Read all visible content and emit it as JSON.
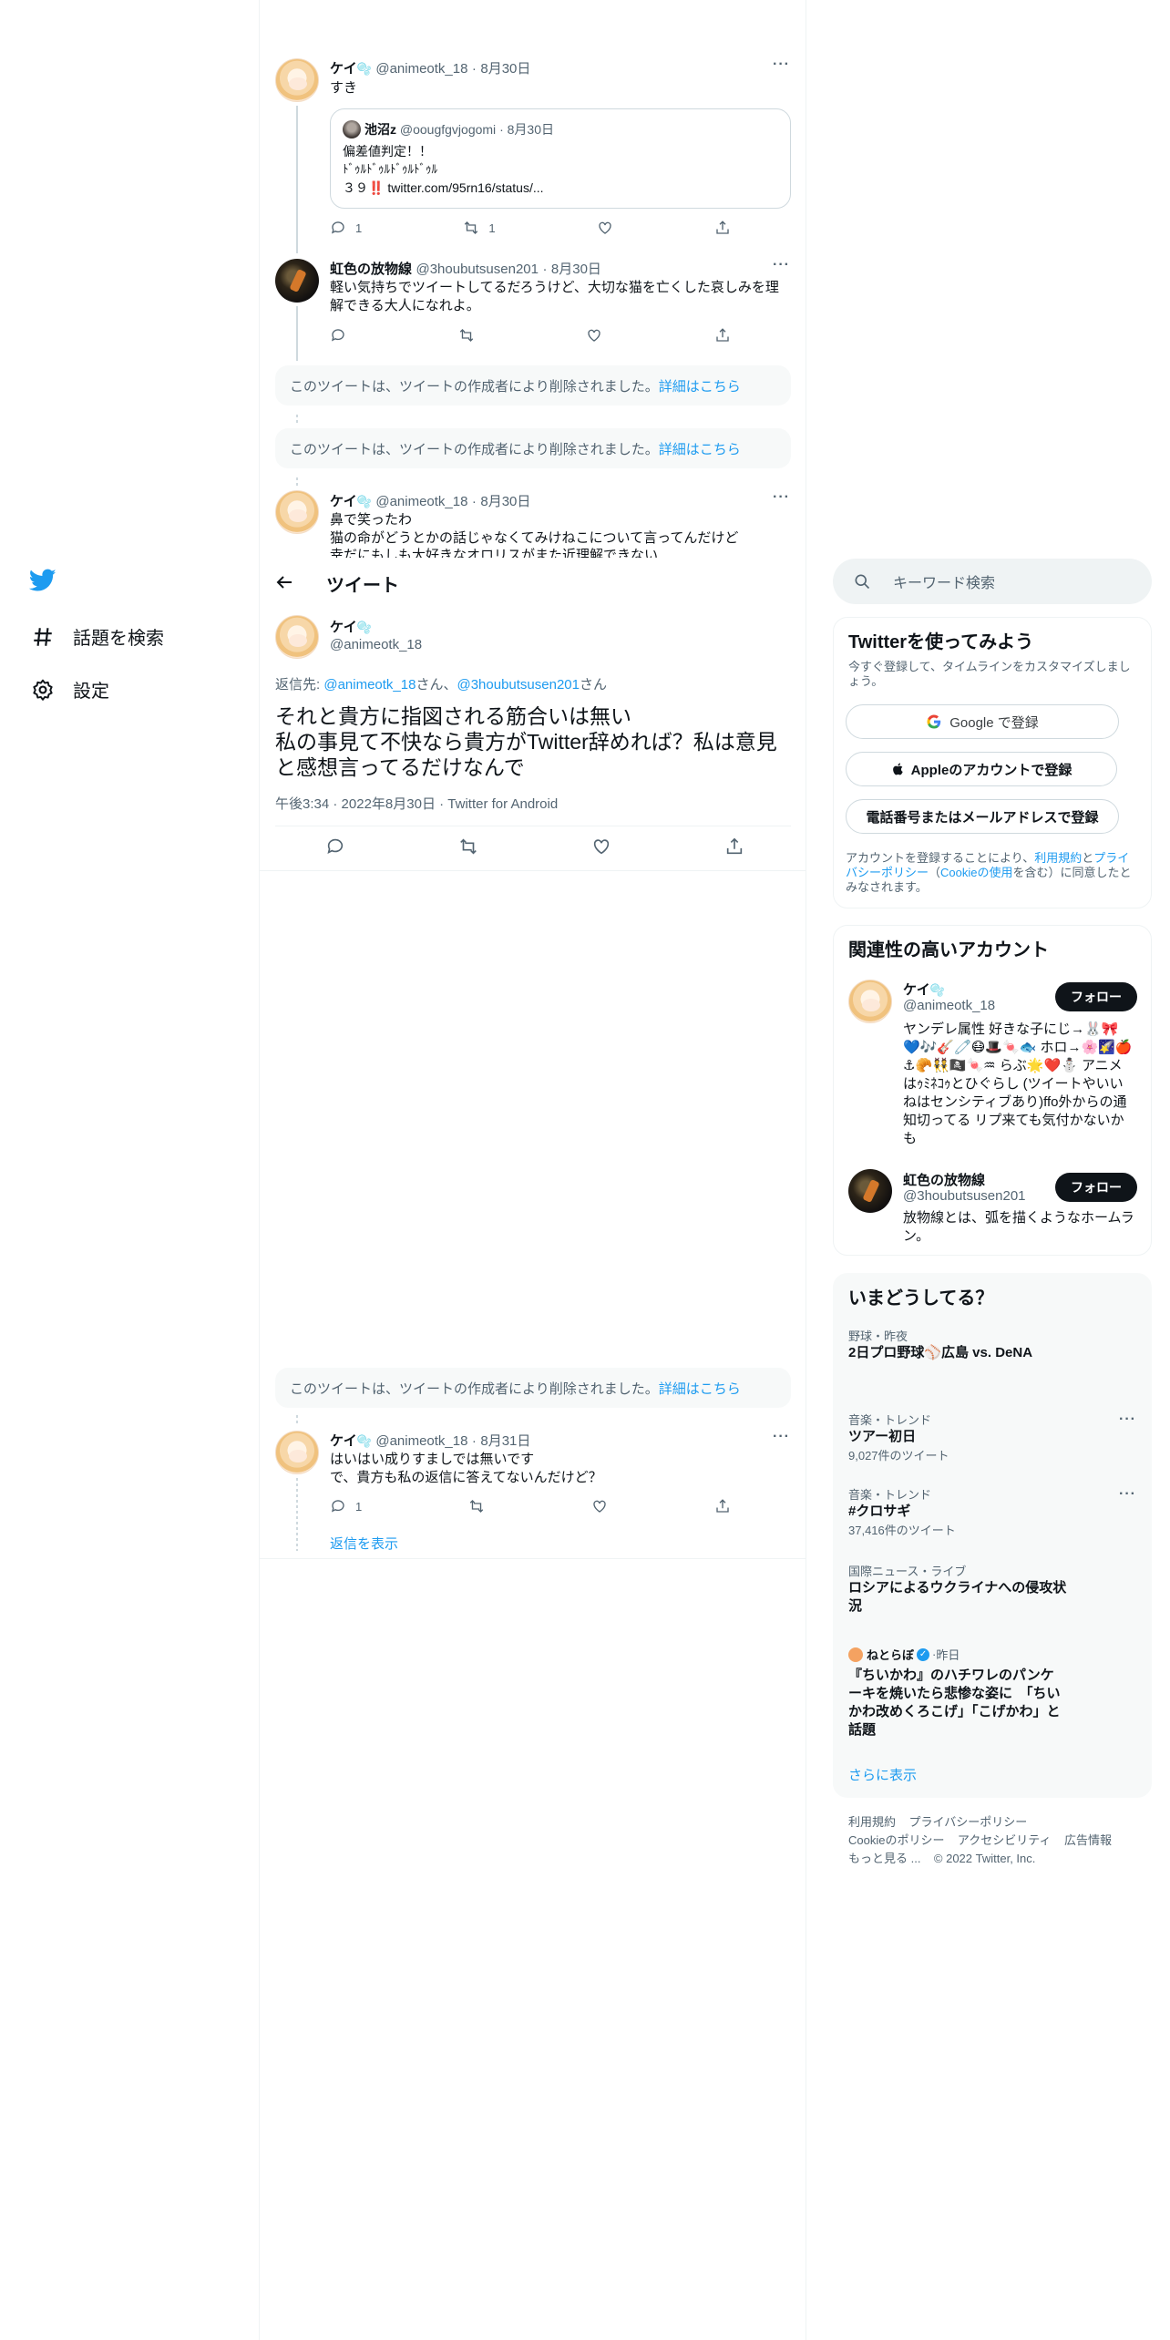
{
  "nav": {
    "explore_label": "話題を検索",
    "settings_label": "設定"
  },
  "timeline": {
    "header_title": "ツイート",
    "tweet1": {
      "name": "ケイ",
      "emoji": "🫧",
      "handle": "@animeotk_18",
      "date": "8月30日",
      "text": "すき",
      "reply_count": "1",
      "retweet_count": "1",
      "quote": {
        "name": "池沼z",
        "handle": "@oougfgvjogomi",
        "date": "8月30日",
        "line1": "偏差値判定！！",
        "line2": "ﾄﾞｩﾙﾄﾞｩﾙﾄﾞｩﾙﾄﾞｩﾙ",
        "line3_prefix": "３９‼️",
        "line3_link": "twitter.com/95rn16/status/..."
      }
    },
    "tweet2": {
      "name": "虹色の放物線",
      "handle": "@3houbutsusen201",
      "date": "8月30日",
      "text": "軽い気持ちでツイートしてるだろうけど、大切な猫を亡くした哀しみを理解できる大人になれよ。"
    },
    "deleted_text": "このツイートは、ツイートの作成者により削除されました。",
    "deleted_link": "詳細はこちら",
    "tweet3": {
      "name": "ケイ",
      "handle": "@animeotk_18",
      "date": "8月30日",
      "line1": "鼻で笑ったわ",
      "line2": "猫の命がどうとかの話じゃなくてみけねこについて言ってんだけど",
      "line3": "幸だにもしも大好きなオロリスがまた近理解できない"
    },
    "main": {
      "name": "ケイ",
      "handle": "@animeotk_18",
      "reply_prefix": "返信先: ",
      "reply_user1": "@animeotk_18",
      "reply_mid": "さん、",
      "reply_user2": "@3houbutsusen201",
      "reply_suffix": "さん",
      "text": "それと貴方に指図される筋合いは無い\n私の事見て不快なら貴方がTwitter辞めれば？私は意見と感想言ってるだけなんで",
      "time": "午後3:34",
      "date": "2022年8月30日",
      "source": "Twitter for Android"
    },
    "tweet5": {
      "name": "ケイ",
      "handle": "@animeotk_18",
      "date": "8月31日",
      "line1": "はいはい成りすましでは無いです",
      "line2": "で、貴方も私の返信に答えてないんだけど？",
      "reply_count": "1",
      "show_replies": "返信を表示"
    }
  },
  "sidebar": {
    "search_placeholder": "キーワード検索",
    "signup": {
      "title": "Twitterを使ってみよう",
      "subtitle": "今すぐ登録して、タイムラインをカスタマイズしましょう。",
      "google_btn": "Google で登録",
      "apple_btn": "Appleのアカウントで登録",
      "phone_btn": "電話番号またはメールアドレスで登録",
      "terms_prefix": "アカウントを登録することにより、",
      "terms_link": "利用規約",
      "terms_and": "と",
      "privacy_link": "プライバシーポリシー",
      "cookie_open": "（",
      "cookie_link": "Cookieの使用",
      "terms_suffix": "を含む）に同意したとみなされます。"
    },
    "related": {
      "title": "関連性の高いアカウント",
      "follow_label": "フォロー",
      "accounts": [
        {
          "name": "ケイ",
          "handle": "@animeotk_18",
          "bio": "ヤンデレ属性 好きな子にじ→🐰🎀💙🎶🎸🧷😷🎩🍬🐟 ホロ→🌸🌠🍎⚓🥐👯🏴‍☠️🍬♒ らぶ🌟❤️⛄ アニメはｩﾐﾈｺｩとひぐらし (ツイートやいいねはセンシティブあり)ffo外からの通知切ってる リプ来ても気付かないかも"
        },
        {
          "name": "虹色の放物線",
          "handle": "@3houbutsusen201",
          "bio": "放物線とは、弧を描くようなホームラン。"
        }
      ]
    },
    "trends": {
      "title": "いまどうしてる？",
      "items": [
        {
          "meta": "野球・昨夜",
          "title": "2日プロ野球⚾広島 vs. DeNA",
          "count": ""
        },
        {
          "meta": "音楽・トレンド",
          "title": "ツアー初日",
          "count": "9,027件のツイート"
        },
        {
          "meta": "音楽・トレンド",
          "title": "#クロサギ",
          "count": "37,416件のツイート"
        },
        {
          "meta": "国際ニュース・ライブ",
          "title": "ロシアによるウクライナへの侵攻状況",
          "count": ""
        }
      ],
      "news": {
        "source": "ねとらぼ",
        "time": "昨日",
        "title": "『ちいかわ』のハチワレのパンケーキを焼いたら悲惨な姿に　「ちいかわ改めくろこげ」「こげかわ」と話題"
      },
      "show_more": "さらに表示"
    },
    "footer": {
      "terms": "利用規約",
      "privacy": "プライバシーポリシー",
      "cookie": "Cookieのポリシー",
      "accessibility": "アクセシビリティ",
      "ads": "広告情報",
      "more": "もっと見る ...",
      "copyright": "© 2022 Twitter, Inc."
    }
  }
}
